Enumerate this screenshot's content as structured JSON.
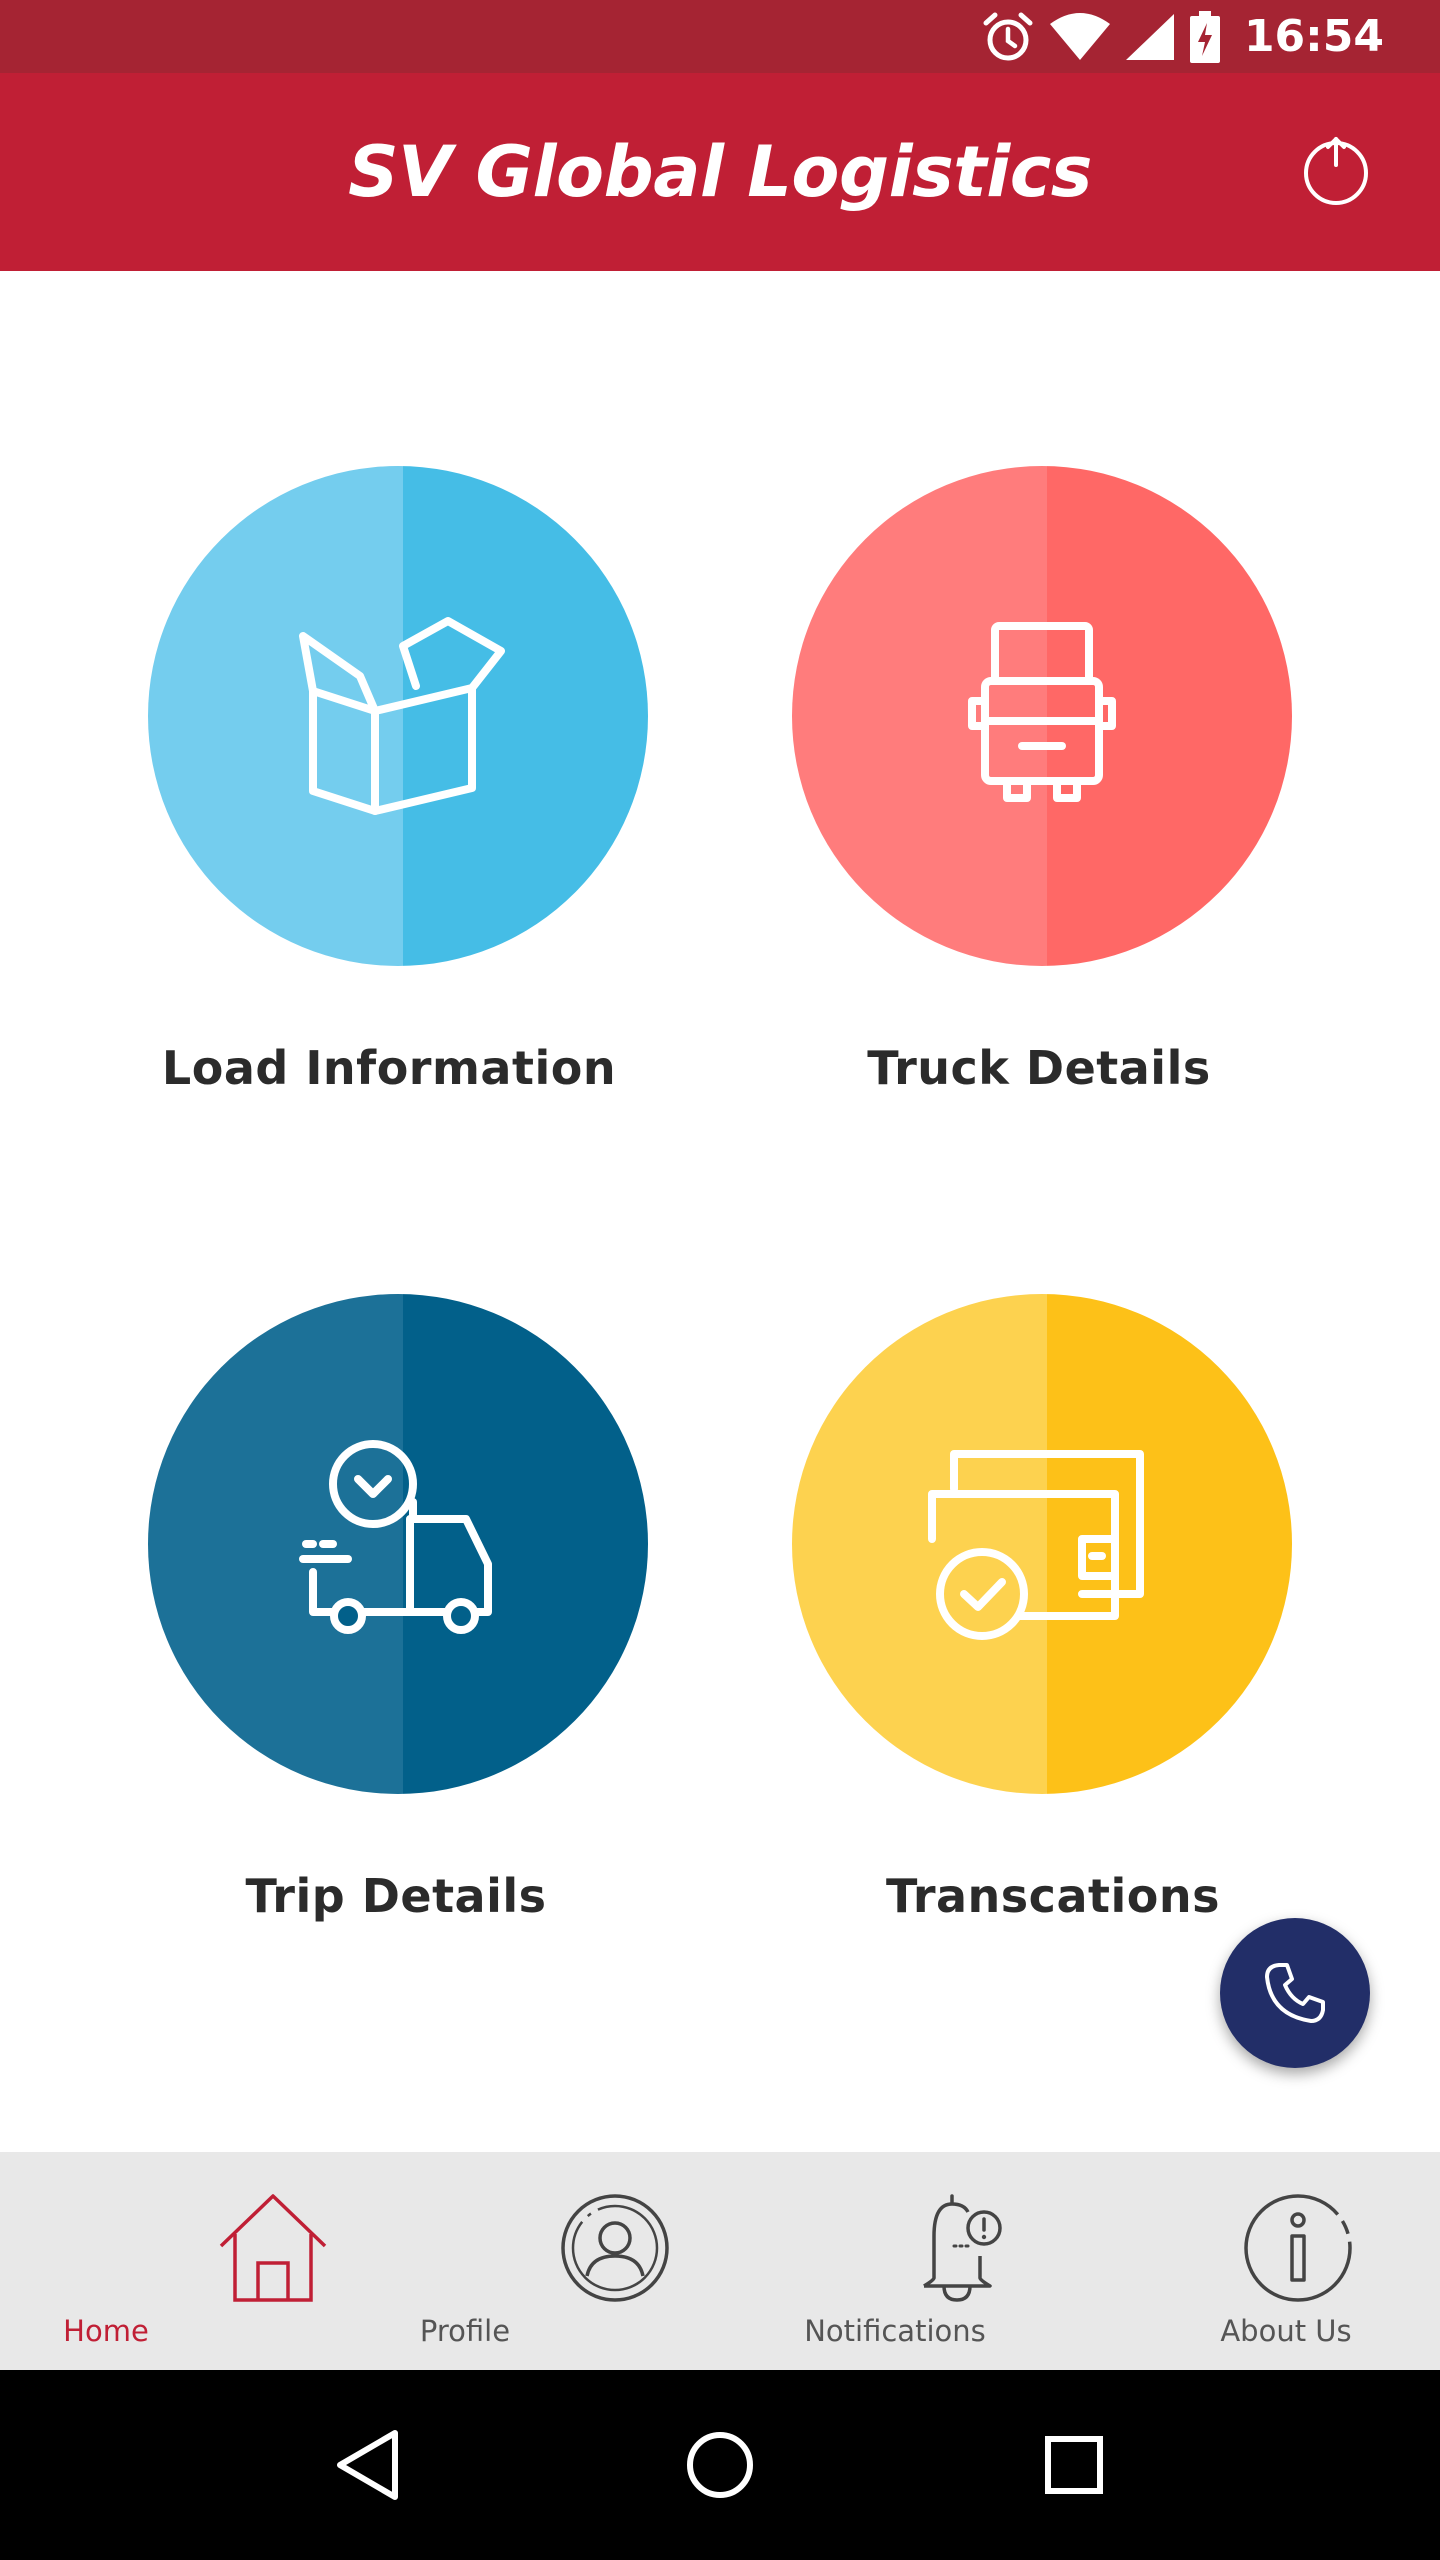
{
  "status_bar": {
    "time": "16:54",
    "icons": [
      "alarm-icon",
      "wifi-icon",
      "signal-icon",
      "battery-charging-icon"
    ]
  },
  "app_bar": {
    "title": "SV Global Logistics",
    "action_icon": "power-icon"
  },
  "tiles": [
    {
      "label": "Load Information",
      "icon": "box-icon",
      "color_light": "#74cdee",
      "color_dark": "#45bde6"
    },
    {
      "label": "Truck Details",
      "icon": "truck-front-icon",
      "color_light": "#ff7c7c",
      "color_dark": "#ff6866"
    },
    {
      "label": "Trip Details",
      "icon": "delivery-time-icon",
      "color_light": "#1c7198",
      "color_dark": "#02608a"
    },
    {
      "label": "Transcations",
      "icon": "wallet-check-icon",
      "color_light": "#fdd24f",
      "color_dark": "#fdc118"
    }
  ],
  "fab": {
    "icon": "phone-icon",
    "color": "#222e68"
  },
  "bottom_nav": {
    "items": [
      {
        "label": "Home",
        "icon": "home-icon",
        "active": true
      },
      {
        "label": "Profile",
        "icon": "profile-icon",
        "active": false
      },
      {
        "label": "Notifications",
        "icon": "bell-icon",
        "active": false
      },
      {
        "label": "About Us",
        "icon": "info-icon",
        "active": false
      }
    ],
    "active_color": "#c01f35"
  },
  "system_nav": {
    "icons": [
      "back-icon",
      "home-circle-icon",
      "recents-icon"
    ]
  },
  "colors": {
    "status_bar": "#a52433",
    "app_bar": "#c01f35"
  }
}
